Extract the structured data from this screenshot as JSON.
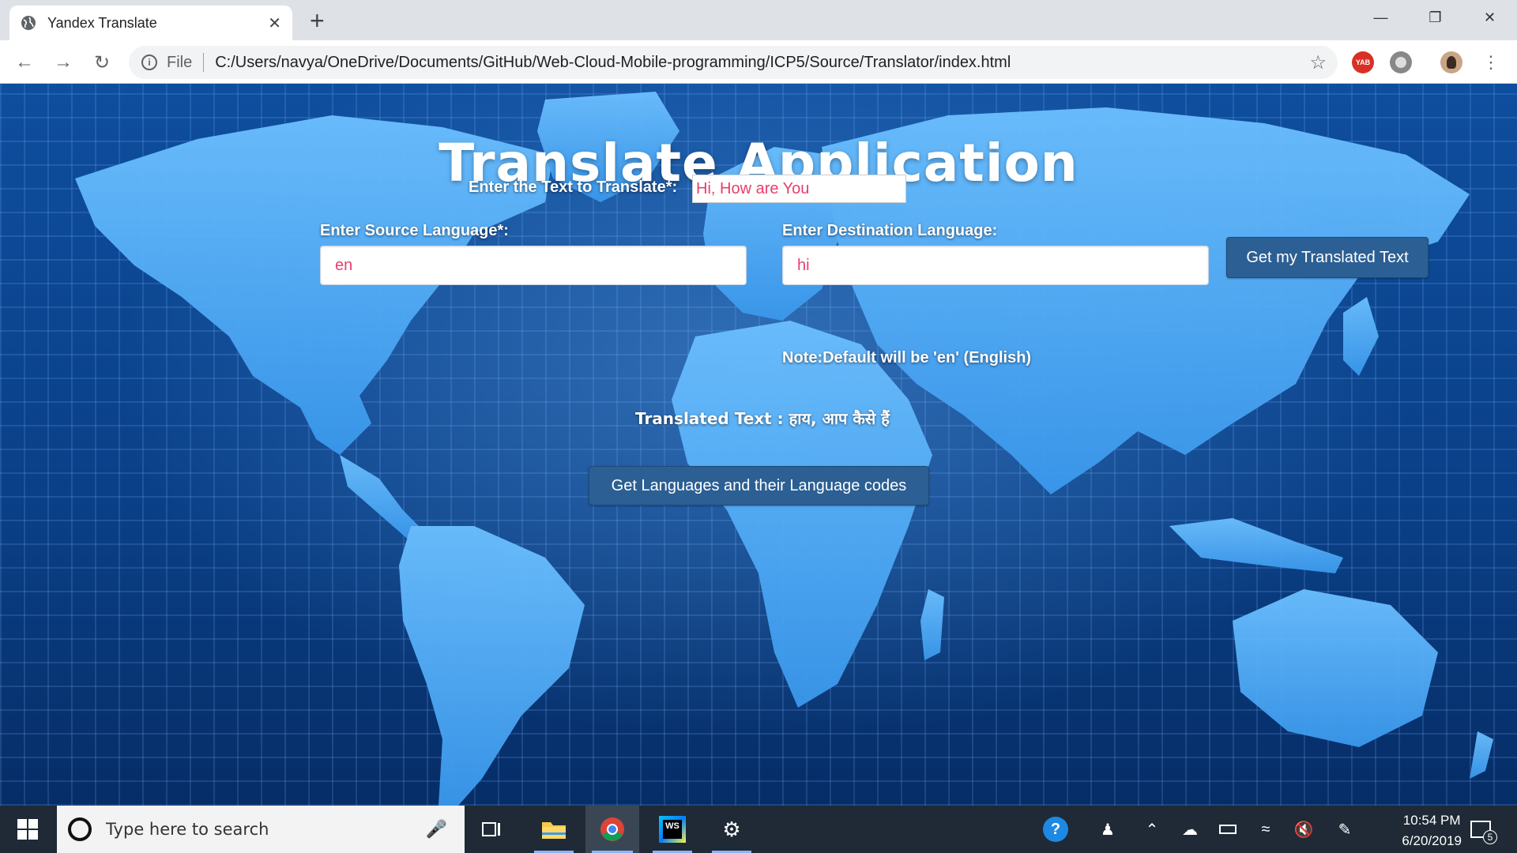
{
  "browser": {
    "tab_title": "Yandex Translate",
    "scheme_label": "File",
    "url": "C:/Users/navya/OneDrive/Documents/GitHub/Web-Cloud-Mobile-programming/ICP5/Source/Translator/index.html",
    "extension_badge": "YAB"
  },
  "page": {
    "title": "Translate Application",
    "text_label": "Enter the Text to Translate*:",
    "text_value": "Hi, How are You",
    "source_label": "Enter Source Language*:",
    "source_value": "en",
    "dest_label": "Enter Destination Language:",
    "dest_value": "hi",
    "note": "Note:Default will be 'en' (English)",
    "translate_button": "Get my Translated Text",
    "result_label": "Translated Text : ",
    "result_value": "हाय, आप कैसे हैं",
    "languages_button": "Get Languages and their Language codes",
    "colors": {
      "input_text": "#e83e6c",
      "button": "#2c5f93",
      "background": "#0b3f86"
    }
  },
  "taskbar": {
    "search_placeholder": "Type here to search",
    "time": "10:54 PM",
    "date": "6/20/2019",
    "notification_count": "5",
    "webstorm_label": "WS"
  }
}
